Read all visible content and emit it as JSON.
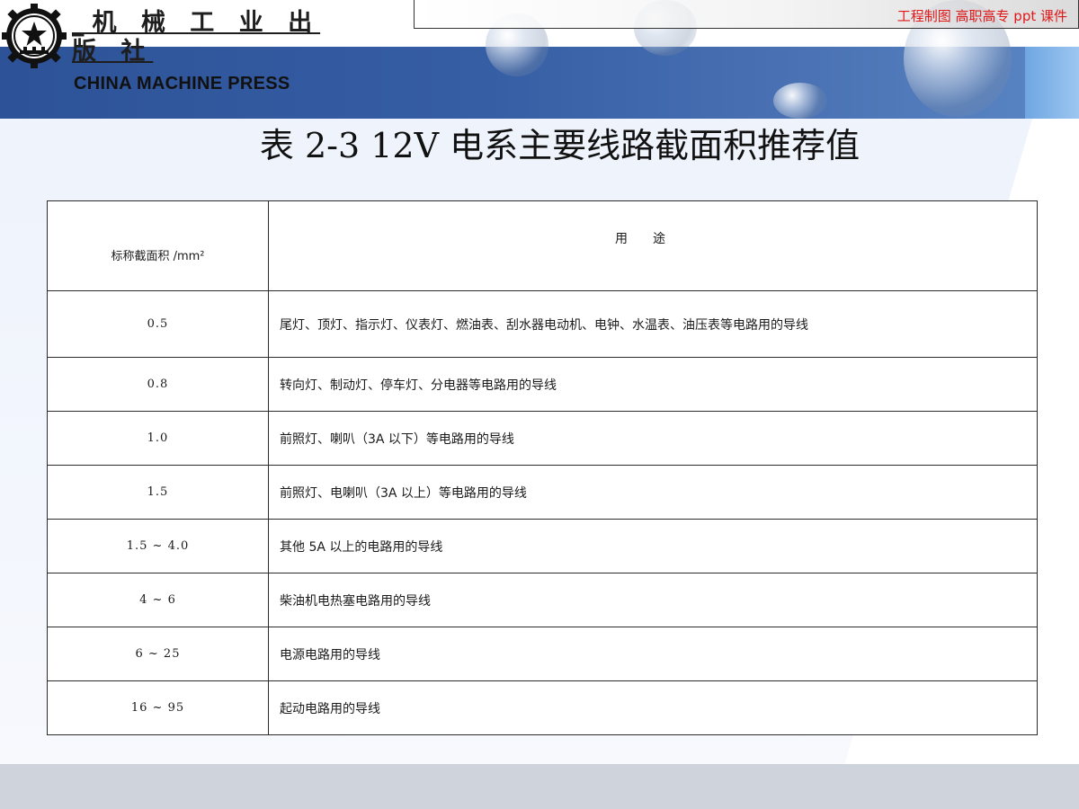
{
  "header": {
    "publisher_cn": "_机 械 工 业 出 版 社",
    "publisher_en": "CHINA  MACHINE PRESS",
    "course_label": "工程制图 高职高专  ppt 课件"
  },
  "title": "表 2-3   12V 电系主要线路截面积推荐值",
  "table": {
    "headers": {
      "area": "标称截面积 /mm²",
      "use": "用途"
    },
    "rows": [
      {
        "area": "0.5",
        "use": "尾灯、顶灯、指示灯、仪表灯、燃油表、刮水器电动机、电钟、水温表、油压表等电路用的导线"
      },
      {
        "area": "0.8",
        "use": "转向灯、制动灯、停车灯、分电器等电路用的导线"
      },
      {
        "area": "1.0",
        "use": "前照灯、喇叭（3A 以下）等电路用的导线"
      },
      {
        "area": "1.5",
        "use": "前照灯、电喇叭（3A 以上）等电路用的导线"
      },
      {
        "area": "1.5 ~ 4.0",
        "use": "其他 5A 以上的电路用的导线"
      },
      {
        "area": "4 ~ 6",
        "use": "柴油机电热塞电路用的导线"
      },
      {
        "area": "6 ~ 25",
        "use": "电源电路用的导线"
      },
      {
        "area": "16 ~ 95",
        "use": "起动电路用的导线"
      }
    ]
  },
  "colors": {
    "header_band": "#2d5298",
    "course_label": "#e01818",
    "bottom_band": "#cfd3dc"
  }
}
